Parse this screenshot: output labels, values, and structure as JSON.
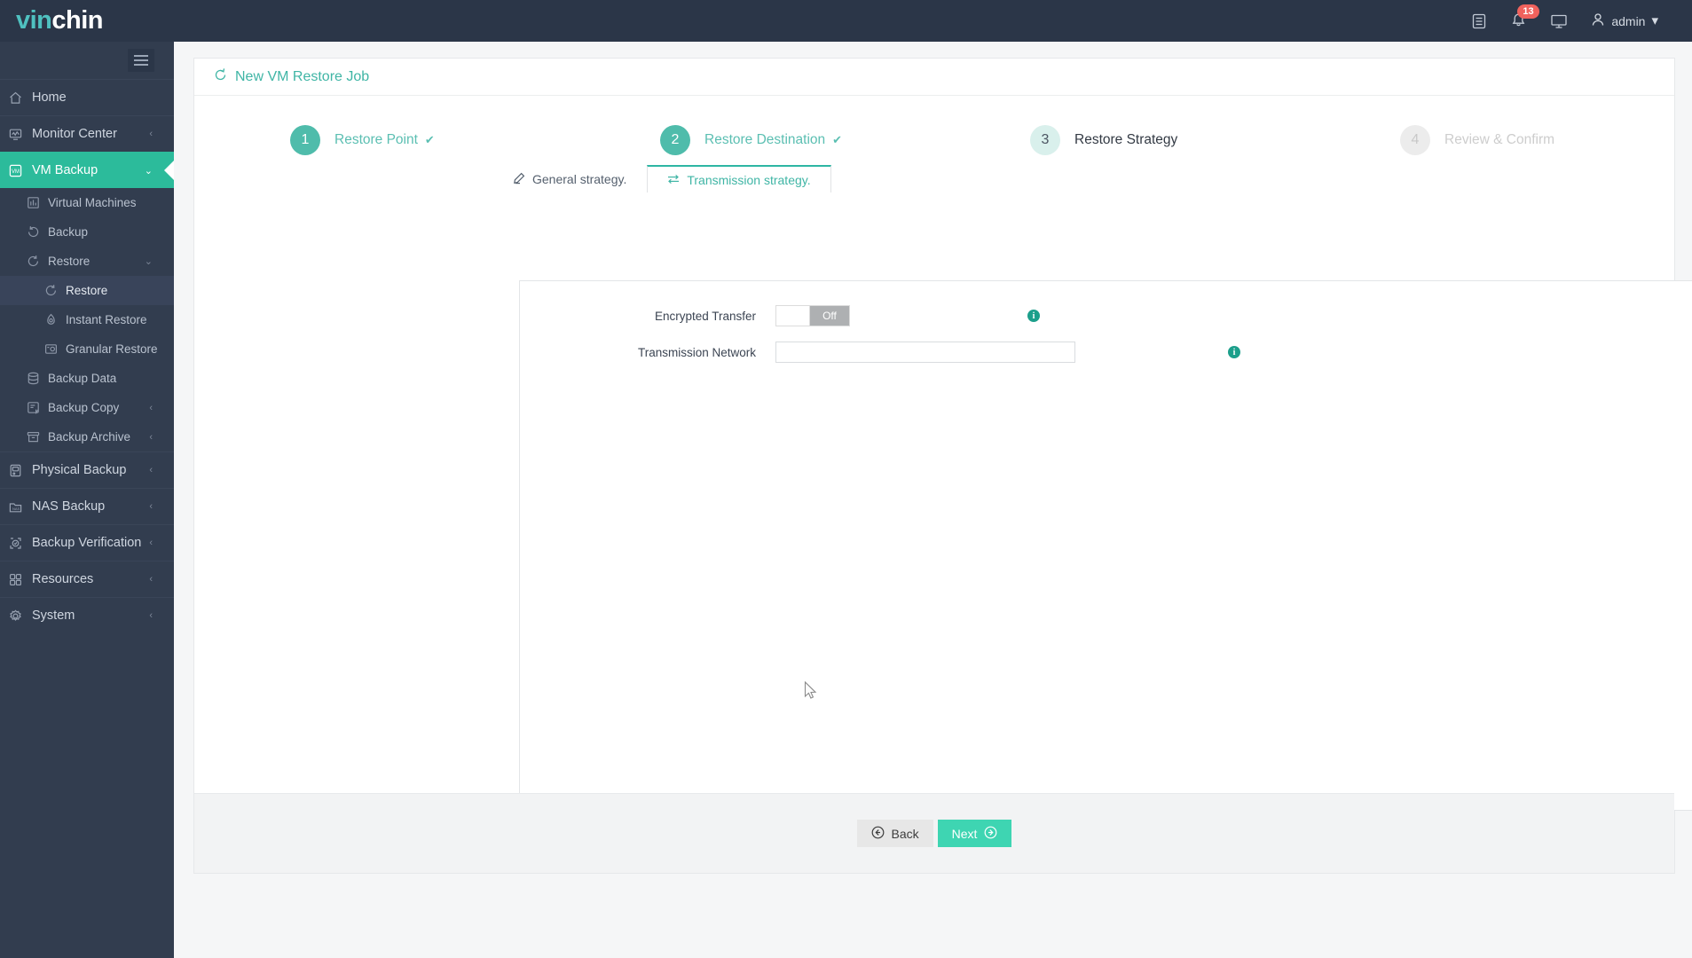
{
  "brand": {
    "part1": "vin",
    "part2": "chin"
  },
  "header": {
    "notes_icon": "document-icon",
    "bell_icon": "bell-icon",
    "notification_count": "13",
    "monitor_icon": "monitor-icon",
    "user_icon": "user-icon",
    "username": "admin",
    "chevron": "⌄"
  },
  "sidebar": {
    "collapse_label": "collapse-menu",
    "items": [
      {
        "label": "Home",
        "icon": "home-icon",
        "caret": "",
        "level": 0,
        "active": false
      },
      {
        "label": "Monitor Center",
        "icon": "monitor-chart-icon",
        "caret": "‹",
        "level": 0,
        "active": false
      },
      {
        "label": "VM Backup",
        "icon": "vm-icon",
        "caret": "⌄",
        "level": 0,
        "active": true
      },
      {
        "label": "Virtual Machines",
        "icon": "chart-bar-icon",
        "caret": "",
        "level": 1,
        "active": false
      },
      {
        "label": "Backup",
        "icon": "backup-refresh-icon",
        "caret": "",
        "level": 1,
        "active": false
      },
      {
        "label": "Restore",
        "icon": "restore-icon",
        "caret": "⌄",
        "level": 1,
        "active": false
      },
      {
        "label": "Restore",
        "icon": "restore-icon",
        "caret": "",
        "level": 2,
        "active": true
      },
      {
        "label": "Instant Restore",
        "icon": "instant-restore-icon",
        "caret": "",
        "level": 2,
        "active": false
      },
      {
        "label": "Granular Restore",
        "icon": "granular-restore-icon",
        "caret": "",
        "level": 2,
        "active": false
      },
      {
        "label": "Backup Data",
        "icon": "database-icon",
        "caret": "",
        "level": 1,
        "active": false
      },
      {
        "label": "Backup Copy",
        "icon": "copy-icon",
        "caret": "‹",
        "level": 1,
        "active": false
      },
      {
        "label": "Backup Archive",
        "icon": "archive-icon",
        "caret": "‹",
        "level": 1,
        "active": false
      },
      {
        "label": "Physical Backup",
        "icon": "server-icon",
        "caret": "‹",
        "level": 0,
        "active": false
      },
      {
        "label": "NAS Backup",
        "icon": "nas-icon",
        "caret": "‹",
        "level": 0,
        "active": false
      },
      {
        "label": "Backup Verification",
        "icon": "shield-check-icon",
        "caret": "‹",
        "level": 0,
        "active": false
      },
      {
        "label": "Resources",
        "icon": "grid-icon",
        "caret": "‹",
        "level": 0,
        "active": false
      },
      {
        "label": "System",
        "icon": "gear-icon",
        "caret": "‹",
        "level": 0,
        "active": false
      }
    ]
  },
  "page": {
    "title": "New VM Restore Job",
    "title_icon": "restore-icon"
  },
  "stepper": {
    "steps": [
      {
        "number": "1",
        "label": "Restore Point",
        "check": "✔",
        "state": "done"
      },
      {
        "number": "2",
        "label": "Restore Destination",
        "check": "✔",
        "state": "done"
      },
      {
        "number": "3",
        "label": "Restore Strategy",
        "check": "",
        "state": "current"
      },
      {
        "number": "4",
        "label": "Review & Confirm",
        "check": "",
        "state": "todo"
      }
    ]
  },
  "tabs": [
    {
      "label": "General strategy.",
      "icon": "pencil-edit-icon",
      "active": false
    },
    {
      "label": "Transmission strategy.",
      "icon": "transfer-arrows-icon",
      "active": true
    }
  ],
  "form": {
    "encrypted_transfer": {
      "label": "Encrypted Transfer",
      "state_text": "Off",
      "info_icon": "info-icon",
      "info_glyph": "i"
    },
    "transmission_network": {
      "label": "Transmission Network",
      "value": "",
      "placeholder": "",
      "info_icon": "info-icon",
      "info_glyph": "i"
    }
  },
  "footer": {
    "back_label": "Back",
    "back_icon": "arrow-left-circle-icon",
    "back_glyph": "←",
    "next_label": "Next",
    "next_icon": "arrow-right-circle-icon",
    "next_glyph": "→"
  },
  "colors": {
    "brand_teal": "#2cbb9b",
    "accent_green": "#3ed5b2",
    "sidebar_bg": "#323d4f",
    "topbar_bg": "#2b3648",
    "badge_red": "#f0625d",
    "info_teal": "#1c9f8b"
  }
}
